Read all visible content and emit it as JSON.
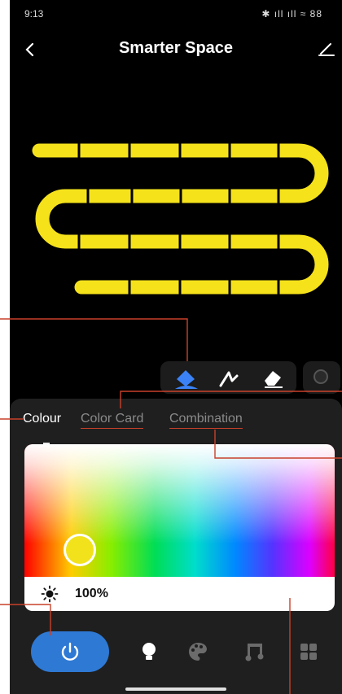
{
  "status_bar": {
    "time": "9:13",
    "right_icons": "✱ ıll ıll ≈ 88"
  },
  "header": {
    "title": "Smarter Space",
    "back_icon": "chevron-left-icon",
    "edit_icon": "pencil-icon"
  },
  "led_color": "#f5e21b",
  "toolbar": {
    "tools": [
      "paint-bucket-icon",
      "pen-icon",
      "eraser-icon"
    ],
    "active_tool_color": "#3b82f6"
  },
  "tabs": {
    "active": "Colour",
    "items": [
      "Colour",
      "Color Card",
      "Combination"
    ]
  },
  "color_picker": {
    "selected_color": "#f2e21c"
  },
  "brightness": {
    "value": "100%",
    "icon": "sun-icon"
  },
  "bottom_nav": {
    "power_color": "#2e79d4",
    "items": [
      "power-icon",
      "bulb-icon",
      "palette-icon",
      "music-icon",
      "grid-icon"
    ]
  },
  "annotation_color": "#c9412a"
}
